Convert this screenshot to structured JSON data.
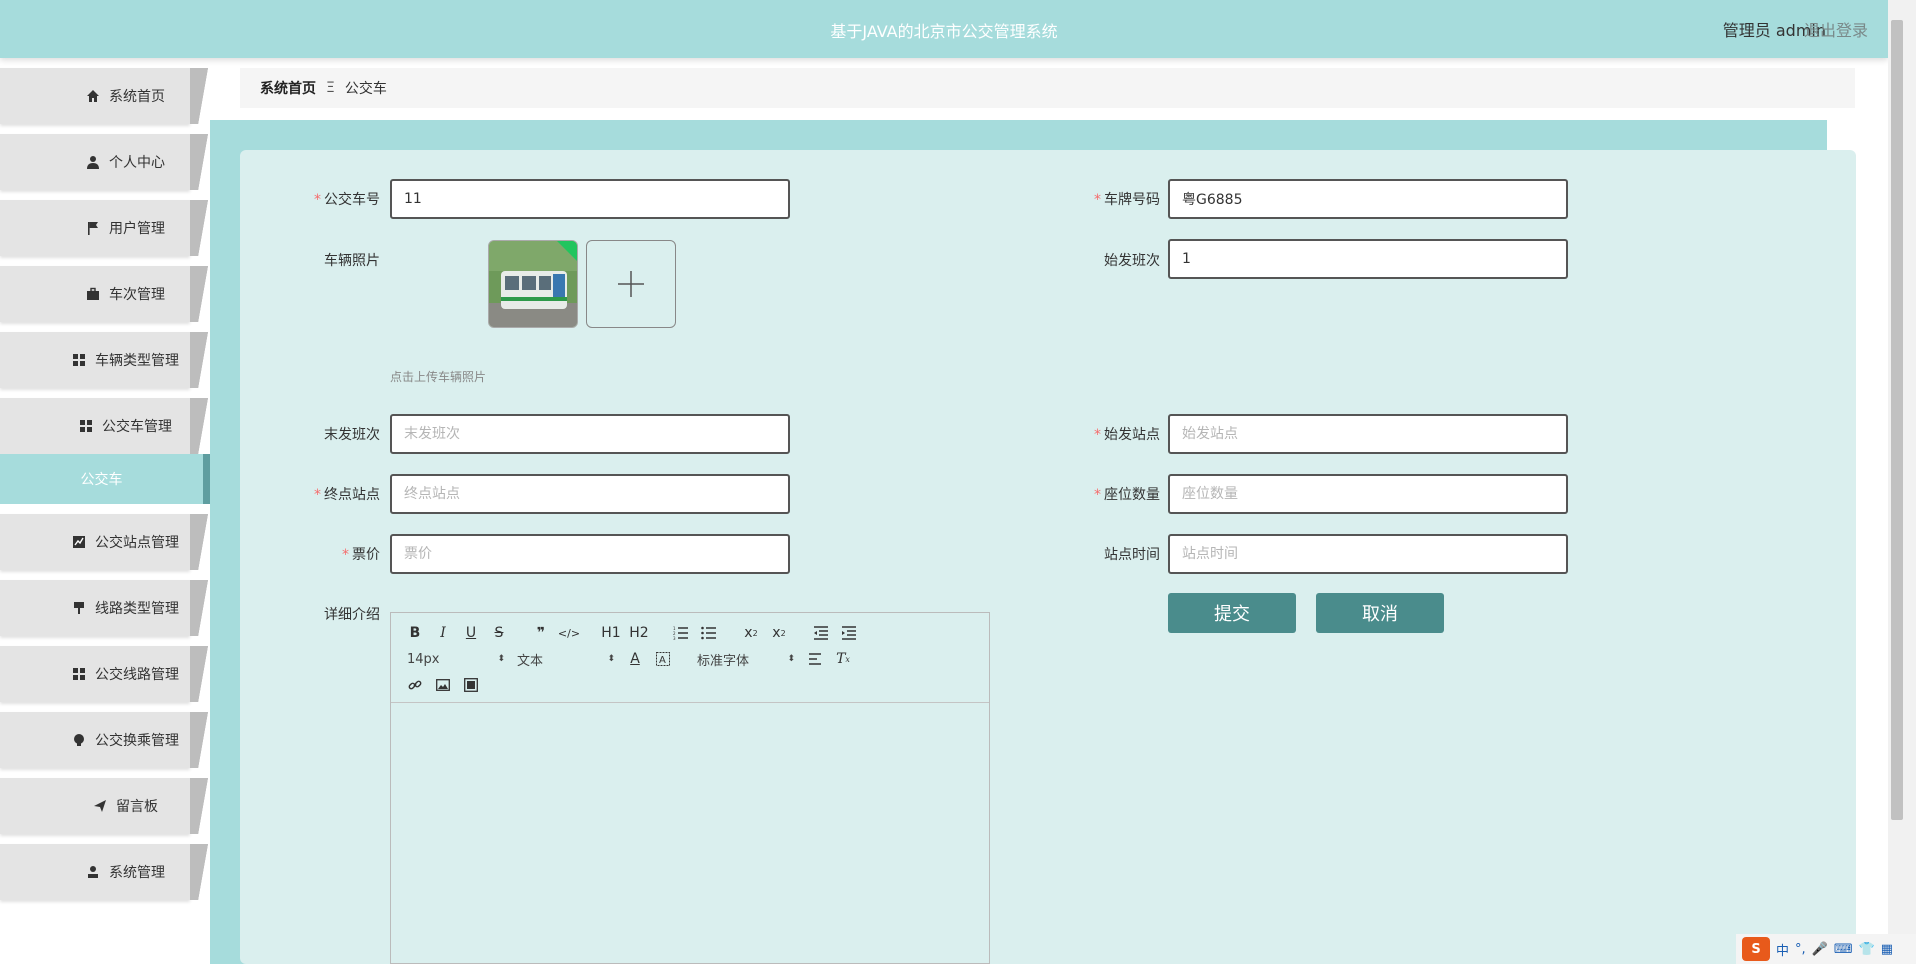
{
  "header": {
    "title": "基于JAVA的北京市公交管理系统",
    "user": "管理员 admin",
    "logout": "退出登录"
  },
  "sidebar": {
    "items": [
      {
        "label": "系统首页",
        "icon": "home-icon"
      },
      {
        "label": "个人中心",
        "icon": "user-icon"
      },
      {
        "label": "用户管理",
        "icon": "flag-icon"
      },
      {
        "label": "车次管理",
        "icon": "briefcase-icon"
      },
      {
        "label": "车辆类型管理",
        "icon": "grid-icon"
      },
      {
        "label": "公交车管理",
        "icon": "grid-icon"
      },
      {
        "label": "公交站点管理",
        "icon": "chart-icon"
      },
      {
        "label": "线路类型管理",
        "icon": "paint-icon"
      },
      {
        "label": "公交线路管理",
        "icon": "grid-icon"
      },
      {
        "label": "公交换乘管理",
        "icon": "bulb-icon"
      },
      {
        "label": "留言板",
        "icon": "send-icon"
      },
      {
        "label": "系统管理",
        "icon": "admin-icon"
      }
    ],
    "active_sub": "公交车"
  },
  "breadcrumb": {
    "home": "系统首页",
    "separator": "Ξ",
    "current": "公交车"
  },
  "form": {
    "bus_no": {
      "label": "公交车号",
      "value": "11"
    },
    "plate": {
      "label": "车牌号码",
      "value": "粤G6885"
    },
    "photo": {
      "label": "车辆照片",
      "hint": "点击上传车辆照片"
    },
    "first_shift": {
      "label": "始发班次",
      "value": "1"
    },
    "last_shift": {
      "label": "末发班次",
      "placeholder": "末发班次"
    },
    "start_station": {
      "label": "始发站点",
      "placeholder": "始发站点"
    },
    "end_station": {
      "label": "终点站点",
      "placeholder": "终点站点"
    },
    "seats": {
      "label": "座位数量",
      "placeholder": "座位数量"
    },
    "fare": {
      "label": "票价",
      "placeholder": "票价"
    },
    "station_time": {
      "label": "站点时间",
      "placeholder": "站点时间"
    },
    "detail": {
      "label": "详细介绍"
    },
    "submit": "提交",
    "cancel": "取消"
  },
  "editor": {
    "font_size": "14px",
    "block_type": "文本",
    "font_family": "标准字体",
    "h1": "H1",
    "h2": "H2"
  },
  "ime": {
    "lang": "中"
  },
  "colors": {
    "header_bg": "#a6dcdc",
    "panel_bg": "#daefee",
    "button": "#4a8c8c",
    "required": "#f56c6c"
  }
}
